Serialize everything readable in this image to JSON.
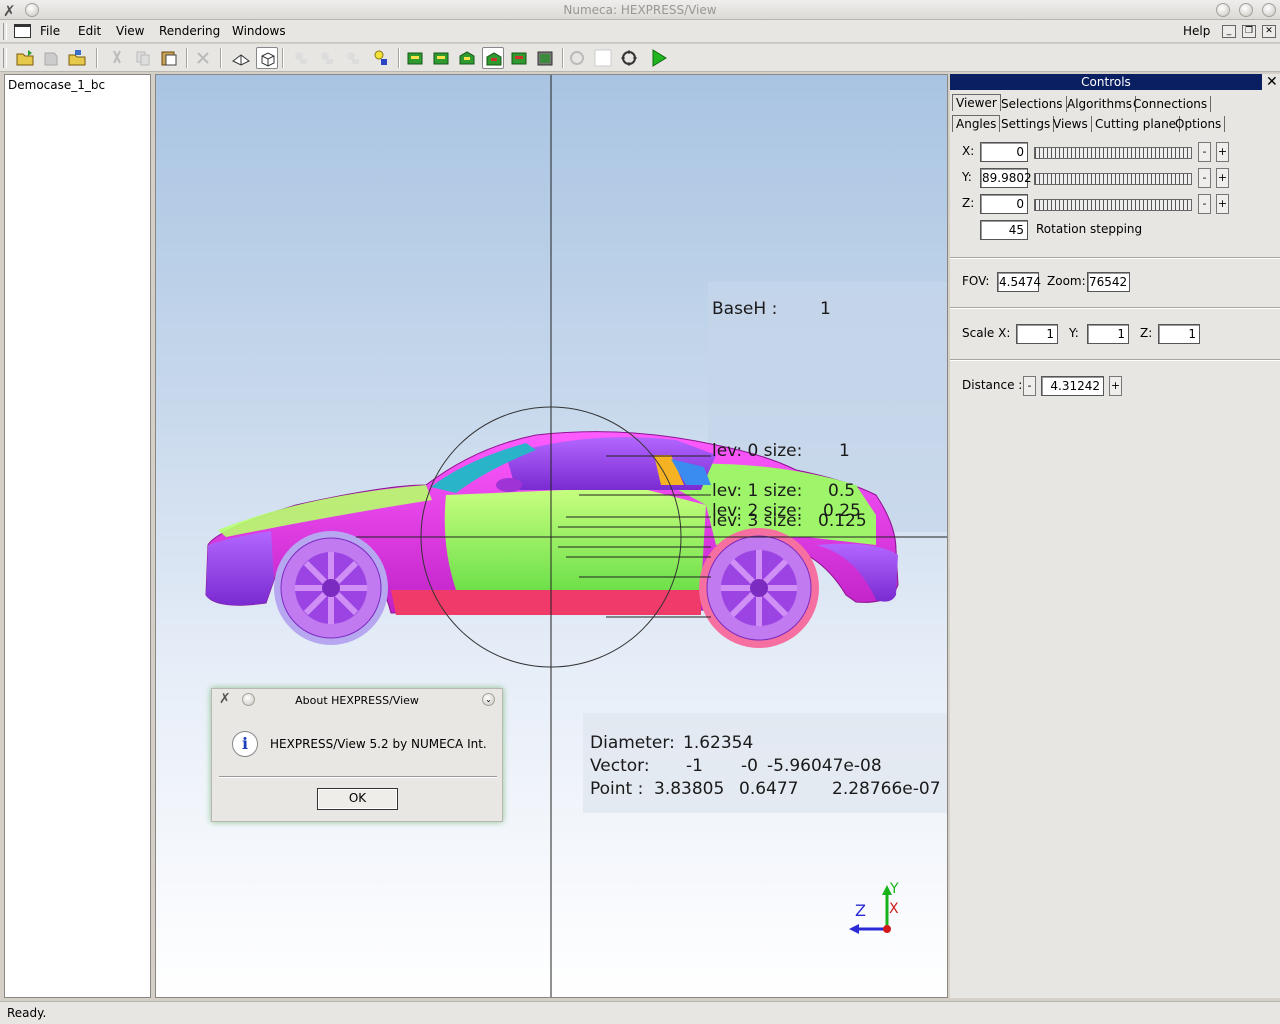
{
  "window": {
    "title": "Numeca: HEXPRESS/View"
  },
  "menu": {
    "file": "File",
    "edit": "Edit",
    "view": "View",
    "rendering": "Rendering",
    "windows": "Windows",
    "help": "Help"
  },
  "tree": {
    "items": [
      "Democase_1_bc"
    ]
  },
  "viewport": {
    "baseh_label": "BaseH :",
    "baseh_value": "1",
    "levels": [
      {
        "label": "lev: 0 size:",
        "value": "1"
      },
      {
        "label": "lev: 1 size:",
        "value": "0.5"
      },
      {
        "label": "lev: 2 size:",
        "value": "0.25"
      },
      {
        "label": "lev: 3 size:",
        "value": "0.125"
      }
    ],
    "info": {
      "diameter_label": "Diameter:",
      "diameter": "1.62354",
      "vector_label": "Vector:",
      "vector": [
        "-1",
        "-0",
        "-5.96047e-08"
      ],
      "point_label": "Point :",
      "point": [
        "3.83805",
        "0.6477",
        "2.28766e-07"
      ]
    },
    "axes": {
      "x": "X",
      "y": "Y",
      "z": "Z"
    }
  },
  "about": {
    "title": "About HEXPRESS/View",
    "message": "HEXPRESS/View 5.2 by NUMECA Int.",
    "ok": "OK"
  },
  "controls": {
    "title": "Controls",
    "tabs_row1": [
      "Viewer",
      "Selections",
      "Algorithms",
      "Connections"
    ],
    "tabs_row2": [
      "Angles",
      "Settings",
      "Views",
      "Cutting plane",
      "Options"
    ],
    "angles": {
      "x_label": "X:",
      "x_value": "0",
      "y_label": "Y:",
      "y_value": "89.9802",
      "z_label": "Z:",
      "z_value": "0",
      "rotation_value": "45",
      "rotation_label": "Rotation stepping"
    },
    "fov_label": "FOV:",
    "fov_value": "4.5474",
    "zoom_label": "Zoom:",
    "zoom_value": "76542",
    "scale_x_label": "Scale X:",
    "scale_x": "1",
    "scale_y_label": "Y:",
    "scale_y": "1",
    "scale_z_label": "Z:",
    "scale_z": "1",
    "distance_label": "Distance :",
    "distance_value": "4.31242",
    "minus": "-",
    "plus": "+"
  },
  "status": {
    "text": "Ready."
  }
}
